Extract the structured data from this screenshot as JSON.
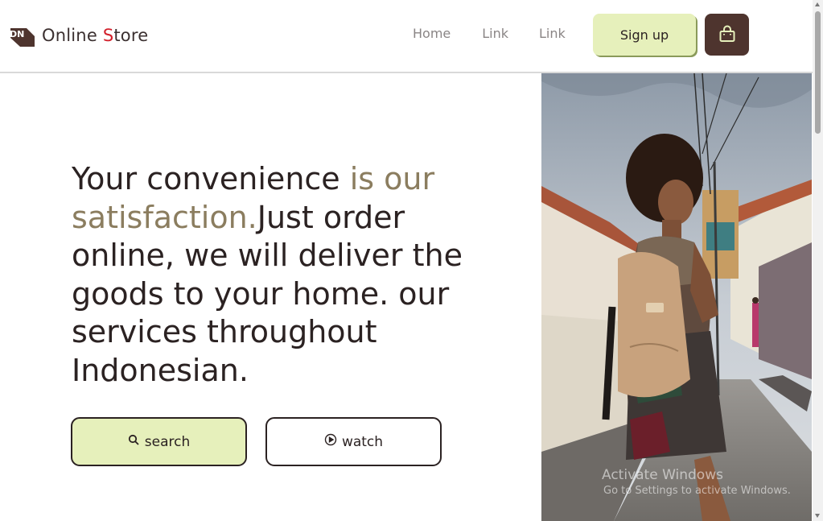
{
  "brand": {
    "prefix": "Online ",
    "accent_letter": "S",
    "suffix": "tore",
    "logo_text": "DN"
  },
  "nav": {
    "links": [
      "Home",
      "Link",
      "Link"
    ],
    "signup_label": "Sign up",
    "cart_icon": "shopping-bag-icon"
  },
  "hero": {
    "text_dark_1": "Your convenience ",
    "text_muted": "is our satisfaction.",
    "text_dark_2": "Just order online, we will deliver the goods to your home. our services throughout Indonesian."
  },
  "actions": {
    "search_label": "search",
    "search_icon": "search-icon",
    "watch_label": "watch",
    "watch_icon": "play-circle-icon"
  },
  "photo": {
    "icon": "woman-with-backpack-photo"
  },
  "watermark": {
    "title": "Activate Windows",
    "subtitle": "Go to Settings to activate Windows."
  },
  "colors": {
    "accent_green": "#e6f0bb",
    "brown": "#4e342e",
    "muted_text": "#8b7d5f",
    "brand_red": "#d21f2a"
  }
}
